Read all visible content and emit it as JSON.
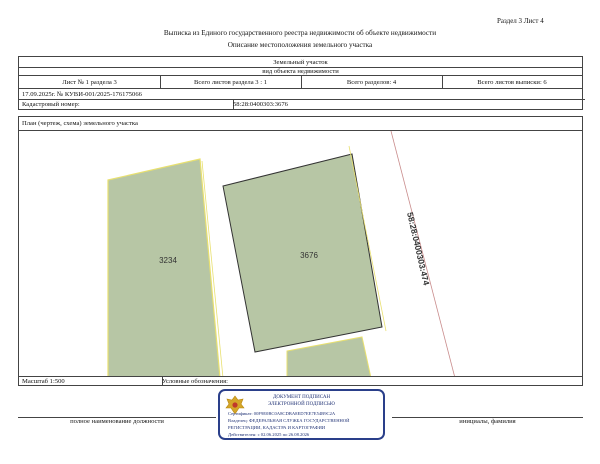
{
  "header": {
    "section_sheet": "Раздел 3   Лист 4",
    "title": "Выписка из Единого государственного реестра недвижимости об объекте недвижимости",
    "subtitle": "Описание местоположения земельного участка"
  },
  "object": {
    "type": "Земельный участок",
    "type_caption": "вид объекта недвижимости"
  },
  "sheet_info": {
    "sheet": "Лист № 1 раздела 3",
    "total_sheets_section": "Всего листов раздела 3 : 1",
    "total_sections": "Всего разделов: 4",
    "total_sheets_extract": "Всего листов выписки: 6"
  },
  "record": {
    "date_number": "17.09.2025г. № КУВИ-001/2025-176175066",
    "cadastral_label": "Кадастровый номер:",
    "cadastral_number": "58:28:0400303:3676"
  },
  "plan": {
    "caption": "План (чертеж, схема) земельного участка",
    "parcels": [
      {
        "label": "3234"
      },
      {
        "label": "3676"
      }
    ],
    "quarter_label": "58:28:0400303:474"
  },
  "footer": {
    "scale": "Масштаб 1:500",
    "legend": "Условные обозначения:",
    "position_caption": "полное наименование должности",
    "name_caption": "инициалы, фамилия"
  },
  "seal": {
    "line1": "ДОКУМЕНТ ПОДПИСАН",
    "line2": "ЭЛЕКТРОННОЙ ПОДПИСЬЮ",
    "cert": "Сертификат: 00F9E0BC0A8CDBA8ED7EE7E54B9C2A",
    "owner": "Владелец: ФЕДЕРАЛЬНАЯ СЛУЖБА ГОСУДАРСТВЕННОЙ",
    "owner2": "РЕГИСТРАЦИИ, КАДАСТРА И КАРТОГРАФИИ",
    "valid": "Действителен: с 02.06.2025 по 26.08.2026"
  }
}
